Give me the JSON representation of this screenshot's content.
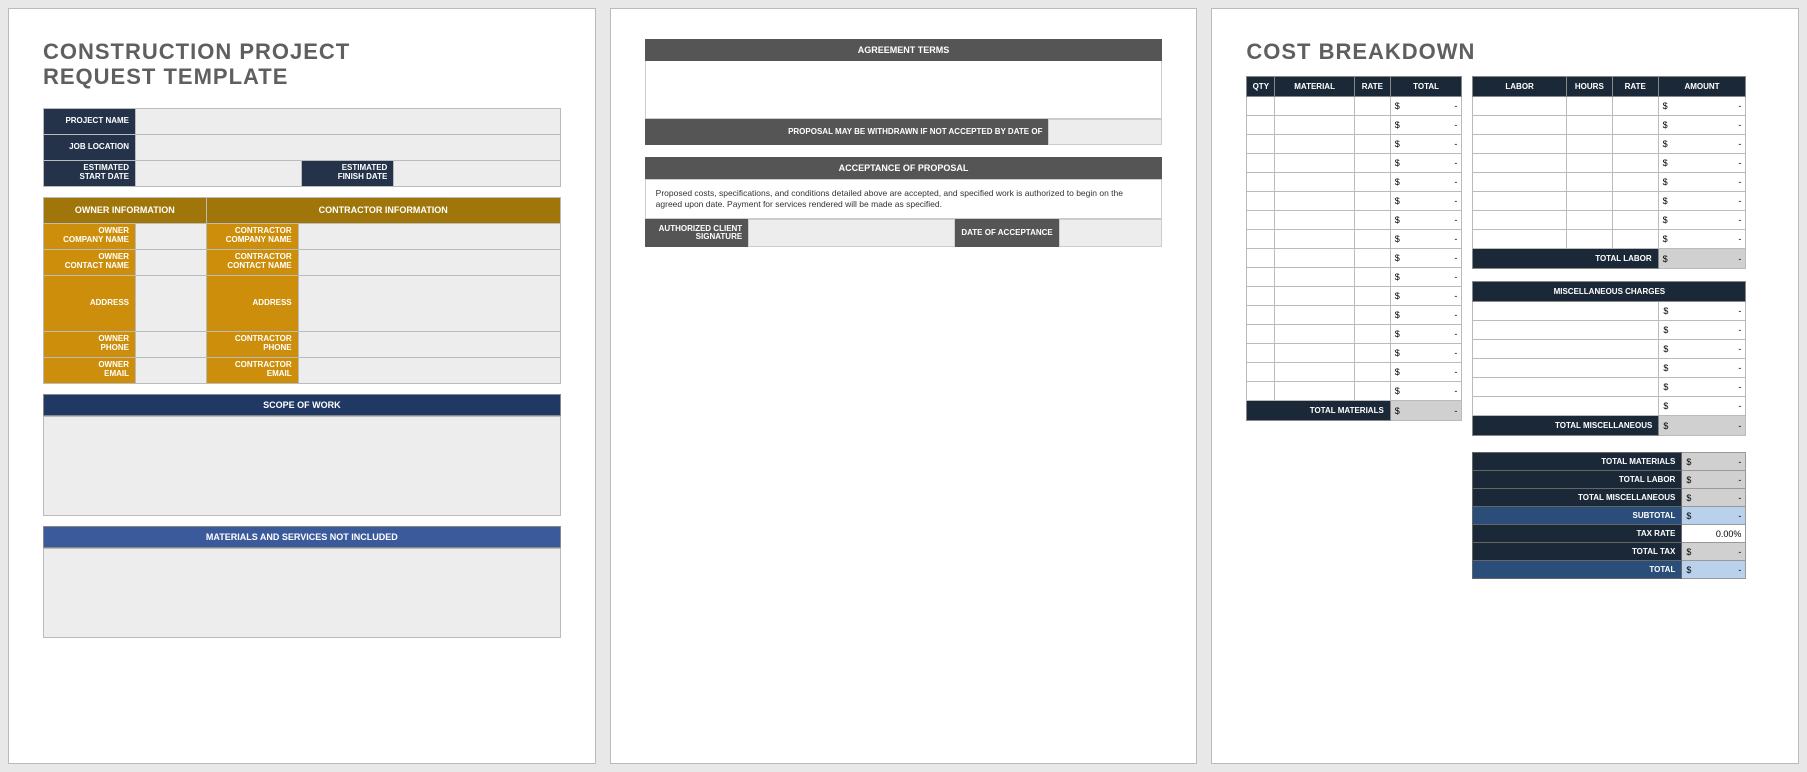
{
  "page1": {
    "title_line1": "CONSTRUCTION PROJECT",
    "title_line2": "REQUEST TEMPLATE",
    "project_name_lbl": "PROJECT NAME",
    "job_location_lbl": "JOB LOCATION",
    "est_start_lbl": "ESTIMATED\nSTART DATE",
    "est_finish_lbl": "ESTIMATED\nFINISH DATE",
    "owner_info_hdr": "OWNER INFORMATION",
    "contractor_info_hdr": "CONTRACTOR INFORMATION",
    "owner_company_lbl": "OWNER\nCOMPANY NAME",
    "contractor_company_lbl": "CONTRACTOR\nCOMPANY NAME",
    "owner_contact_lbl": "OWNER\nCONTACT NAME",
    "contractor_contact_lbl": "CONTRACTOR\nCONTACT NAME",
    "address_lbl": "ADDRESS",
    "owner_phone_lbl": "OWNER\nPHONE",
    "contractor_phone_lbl": "CONTRACTOR\nPHONE",
    "owner_email_lbl": "OWNER\nEMAIL",
    "contractor_email_lbl": "CONTRACTOR EMAIL",
    "scope_hdr": "SCOPE OF WORK",
    "materials_hdr": "MATERIALS AND SERVICES NOT INCLUDED"
  },
  "page2": {
    "agreement_terms_hdr": "AGREEMENT TERMS",
    "withdrawn_lbl": "PROPOSAL MAY BE WITHDRAWN IF NOT ACCEPTED BY DATE OF",
    "acceptance_hdr": "ACCEPTANCE OF PROPOSAL",
    "acceptance_text": "Proposed costs, specifications, and conditions detailed above are accepted, and specified work is authorized to begin on the agreed upon date.  Payment for services rendered will be made as specified.",
    "auth_sig_lbl": "AUTHORIZED CLIENT\nSIGNATURE",
    "date_acc_lbl": "DATE OF ACCEPTANCE"
  },
  "page3": {
    "title": "COST BREAKDOWN",
    "materials_headers": [
      "QTY",
      "MATERIAL",
      "RATE",
      "TOTAL"
    ],
    "labor_headers": [
      "LABOR",
      "HOURS",
      "RATE",
      "AMOUNT"
    ],
    "total_materials_lbl": "TOTAL MATERIALS",
    "total_labor_lbl": "TOTAL LABOR",
    "misc_hdr": "MISCELLANEOUS CHARGES",
    "total_misc_lbl": "TOTAL MISCELLANEOUS",
    "totals": {
      "total_materials": "TOTAL MATERIALS",
      "total_labor": "TOTAL LABOR",
      "total_misc": "TOTAL MISCELLANEOUS",
      "subtotal": "SUBTOTAL",
      "tax_rate": "TAX RATE",
      "tax_rate_val": "0.00%",
      "total_tax": "TOTAL TAX",
      "total": "TOTAL"
    },
    "dash": "-",
    "currency": "$"
  }
}
